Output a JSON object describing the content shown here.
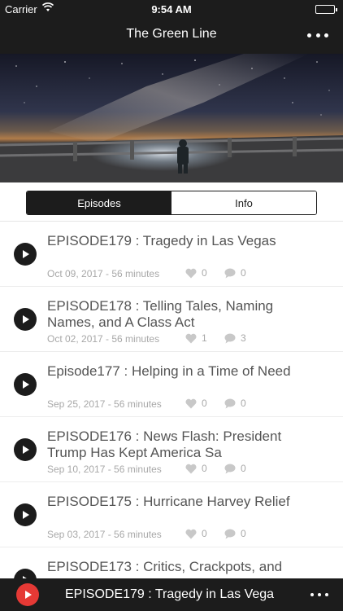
{
  "status_bar": {
    "carrier": "Carrier",
    "time": "9:54 AM"
  },
  "nav": {
    "title": "The Green Line"
  },
  "tabs": [
    {
      "label": "Episodes",
      "active": true
    },
    {
      "label": "Info",
      "active": false
    }
  ],
  "episodes": [
    {
      "title": "EPISODE179 : Tragedy in Las Vegas",
      "meta": "Oct 09, 2017 - 56 minutes",
      "likes": "0",
      "comments": "0"
    },
    {
      "title": "EPISODE178 : Telling Tales, Naming Names, and A Class Act",
      "meta": "Oct 02, 2017 - 56 minutes",
      "likes": "1",
      "comments": "3"
    },
    {
      "title": "Episode177 : Helping in a Time of Need",
      "meta": "Sep 25, 2017 - 56 minutes",
      "likes": "0",
      "comments": "0"
    },
    {
      "title": "EPISODE176 : News Flash: President Trump Has Kept America Sa",
      "meta": "Sep 10, 2017 - 56 minutes",
      "likes": "0",
      "comments": "0"
    },
    {
      "title": "EPISODE175 : Hurricane Harvey Relief",
      "meta": "Sep 03, 2017 - 56 minutes",
      "likes": "0",
      "comments": "0"
    },
    {
      "title": "EPISODE173 : Critics, Crackpots, and",
      "meta": "",
      "likes": "",
      "comments": ""
    }
  ],
  "player": {
    "now_playing": "EPISODE179 : Tragedy in Las Vega"
  },
  "colors": {
    "bar": "#1c1c1c",
    "accent": "#e53935",
    "battery": "#4cd964"
  }
}
